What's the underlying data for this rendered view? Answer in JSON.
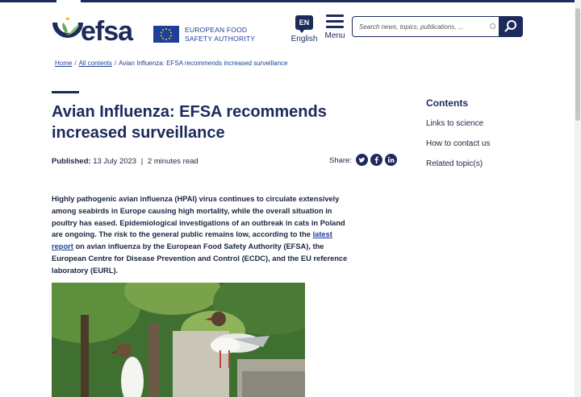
{
  "header": {
    "logo_text": "efsa",
    "eu_label_line1": "EUROPEAN FOOD",
    "eu_label_line2": "SAFETY AUTHORITY",
    "lang_code": "EN",
    "lang_label": "English",
    "menu_label": "Menu",
    "search_placeholder": "Search news, topics, publications, ..."
  },
  "breadcrumb": {
    "home": "Home",
    "all_contents": "All contents",
    "current": "Avian Influenza: EFSA recommends increased surveillance"
  },
  "article": {
    "title": "Avian Influenza: EFSA recommends increased surveillance",
    "published_label": "Published:",
    "published_date": "13 July 2023",
    "separator": "|",
    "read_time": "2 minutes read",
    "share_label": "Share:",
    "intro_part1": "Highly pathogenic avian influenza (HPAI) virus continues to circulate extensively among seabirds in Europe causing high mortality, while the overall situation in poultry has eased. Epidemiological investigations of an outbreak in cats in Poland are ongoing. The risk to the general public remains low, according to the ",
    "intro_link": "latest report",
    "intro_part2": " on avian influenza by the European Food Safety Authority (EFSA), the European Centre for Disease Prevention and Control (ECDC), and the EU reference laboratory (EURL)."
  },
  "share_icons": [
    "twitter-icon",
    "facebook-icon",
    "linkedin-icon"
  ],
  "sidebar": {
    "title": "Contents",
    "items": [
      "Links to science",
      "How to contact us",
      "Related topic(s)"
    ]
  },
  "colors": {
    "brand_navy": "#1c2a5c",
    "eu_blue": "#1f3f9a",
    "logo_green": "#6aa84f",
    "link_blue": "#1f3f9a"
  }
}
